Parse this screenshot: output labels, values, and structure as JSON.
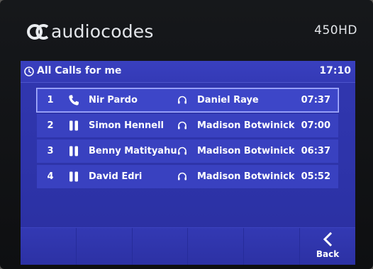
{
  "brand": {
    "name": "audiocodes",
    "model": "450HD"
  },
  "screen": {
    "title": "All Calls for me",
    "time": "17:10"
  },
  "calls": [
    {
      "index": "1",
      "state": "phone-handset-icon",
      "caller": "Nir Pardo",
      "agent": "Daniel Raye",
      "duration": "07:37",
      "selected": true
    },
    {
      "index": "2",
      "state": "pause-icon",
      "caller": "Simon Hennell",
      "agent": "Madison Botwinick",
      "duration": "07:00",
      "selected": false
    },
    {
      "index": "3",
      "state": "pause-icon",
      "caller": "Benny Matityahu",
      "agent": "Madison Botwinick",
      "duration": "06:37",
      "selected": false
    },
    {
      "index": "4",
      "state": "pause-icon",
      "caller": "David Edri",
      "agent": "Madison Botwinick",
      "duration": "05:52",
      "selected": false
    }
  ],
  "softkeys": [
    {
      "label": ""
    },
    {
      "label": ""
    },
    {
      "label": ""
    },
    {
      "label": ""
    },
    {
      "label": ""
    },
    {
      "label": "Back"
    }
  ],
  "colors": {
    "screen_bg": "#2d33a8",
    "row_bg": "#3941c0",
    "selected_outline": "#aeb6ff",
    "text": "#ffffff"
  }
}
